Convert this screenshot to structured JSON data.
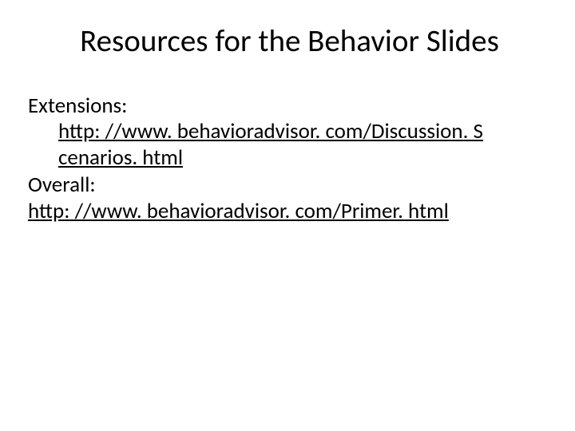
{
  "title": "Resources for the Behavior Slides",
  "body": {
    "extensions_label": "Extensions:",
    "extensions_link_line1": "http: //www. behavioradvisor. com/Discussion. S",
    "extensions_link_line2": "cenarios. html",
    "overall_label": "Overall:",
    "overall_link": "http: //www. behavioradvisor. com/Primer. html"
  }
}
